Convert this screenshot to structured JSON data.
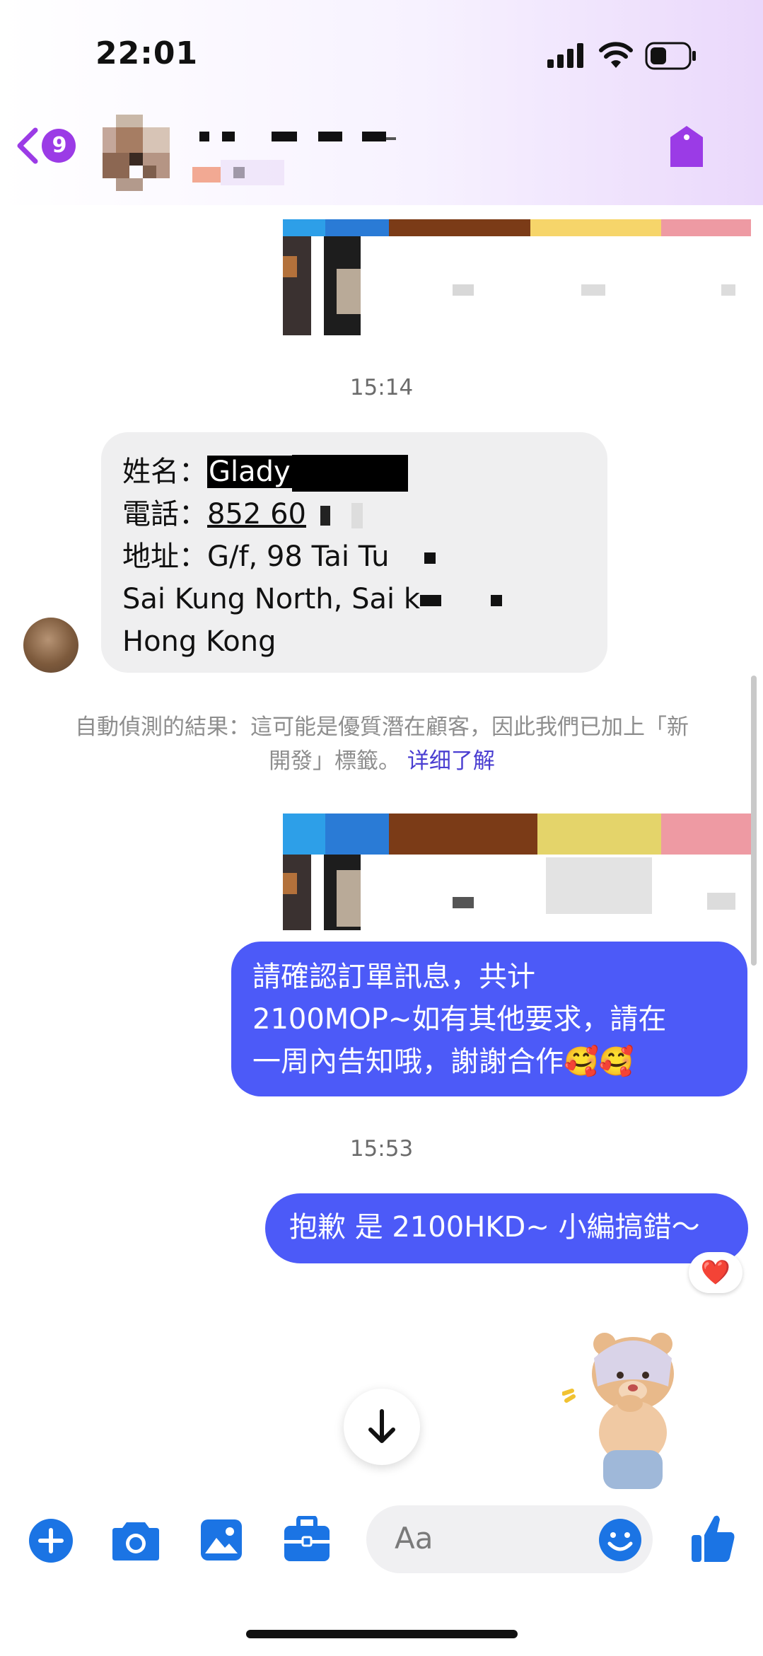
{
  "status_bar": {
    "time": "22:01"
  },
  "header": {
    "unread_count": "9"
  },
  "messages": {
    "timestamp_1": "15:14",
    "incoming_address": {
      "name_label": "姓名：",
      "name_value": "Glady",
      "phone_label": "電話：",
      "phone_value": "852 60",
      "address_label": "地址：",
      "address_value": "G/f, 98 Tai Tu",
      "address_line2": "Sai Kung North, Sai k",
      "address_line3": "Hong Kong"
    },
    "system_note": {
      "text_1": "自動偵測的結果：這可能是優質潛在顧客，因此我們已加上「新",
      "text_2": "開發」標籤。",
      "link": "详细了解"
    },
    "outgoing_1": {
      "line_1": "請確認訂單訊息，共计",
      "line_2": "2100MOP~如有其他要求，請在",
      "line_3": "一周內告知哦，謝謝合作🥰🥰"
    },
    "timestamp_2": "15:53",
    "outgoing_2": "抱歉 是 2100HKD~ 小編搞錯～",
    "reaction": "❤️"
  },
  "composer": {
    "placeholder": "Aa"
  },
  "colors": {
    "accent": "#4c5af8",
    "header_purple": "#9b3be6",
    "icon_blue": "#1b74e4"
  }
}
